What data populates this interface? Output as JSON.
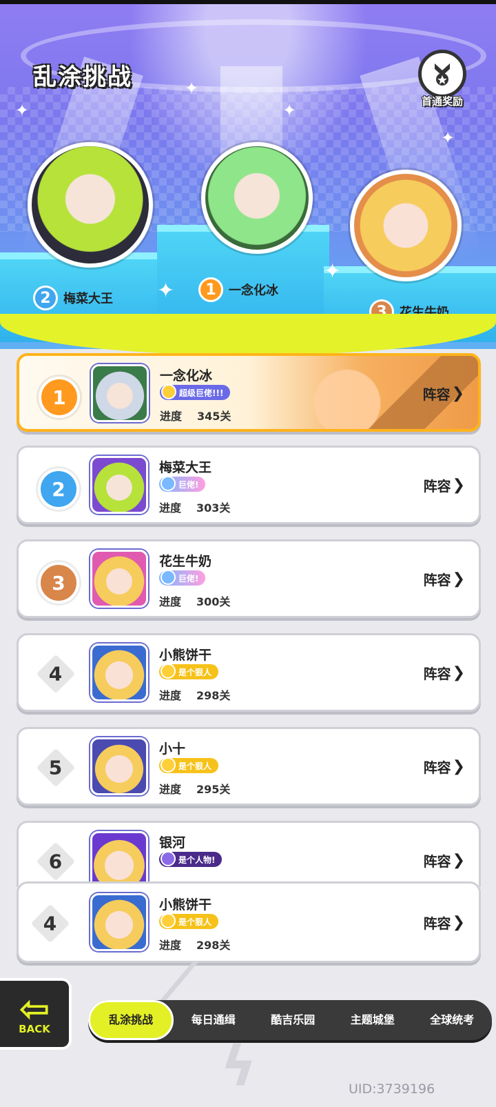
{
  "header": {
    "title": "乱涂挑战",
    "reward_label": "首通奖励",
    "reward_icon": "medal-icon"
  },
  "podium": [
    {
      "rank": "2",
      "name": "梅菜大王",
      "color": "#3fa6ef"
    },
    {
      "rank": "1",
      "name": "一念化冰",
      "color": "#ff9a1f"
    },
    {
      "rank": "3",
      "name": "花生牛奶",
      "color": "#d9864a"
    }
  ],
  "ranking": [
    {
      "rank": "1",
      "name": "一念化冰",
      "title": "超级巨佬!!!",
      "progress_label": "进度",
      "progress": "345关",
      "lineup": "阵容",
      "style": "gold"
    },
    {
      "rank": "2",
      "name": "梅菜大王",
      "title": "巨佬!",
      "progress_label": "进度",
      "progress": "303关",
      "lineup": "阵容",
      "style": "silver"
    },
    {
      "rank": "3",
      "name": "花生牛奶",
      "title": "巨佬!",
      "progress_label": "进度",
      "progress": "300关",
      "lineup": "阵容",
      "style": "bronze"
    },
    {
      "rank": "4",
      "name": "小熊饼干",
      "title": "是个狠人",
      "progress_label": "进度",
      "progress": "298关",
      "lineup": "阵容",
      "style": "plain"
    },
    {
      "rank": "5",
      "name": "小十",
      "title": "是个狠人",
      "progress_label": "进度",
      "progress": "295关",
      "lineup": "阵容",
      "style": "plain"
    },
    {
      "rank": "6",
      "name": "银河",
      "title": "是个人物!",
      "progress_label": "",
      "progress": "",
      "lineup": "阵容",
      "style": "plain"
    }
  ],
  "my_rank": {
    "rank": "4",
    "name": "小熊饼干",
    "title": "是个狠人",
    "progress_label": "进度",
    "progress": "298关",
    "lineup": "阵容"
  },
  "nav": {
    "back_label": "BACK",
    "tabs": [
      "乱涂挑战",
      "每日通缉",
      "酷吉乐园",
      "主题城堡",
      "全球统考"
    ],
    "active_tab": "乱涂挑战"
  },
  "uid": "UID:3739196",
  "colors": {
    "accent": "#e3f026",
    "gold": "#ffb31a",
    "dark": "#3a3a3a"
  }
}
